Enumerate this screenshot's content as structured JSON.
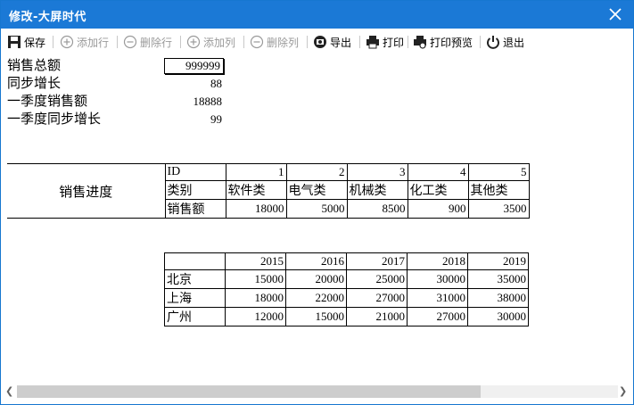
{
  "window": {
    "title": "修改-大屏时代",
    "close_label": "×"
  },
  "toolbar": {
    "save": "保存",
    "add_row": "添加行",
    "delete_row": "删除行",
    "add_col": "添加列",
    "delete_col": "删除列",
    "export": "导出",
    "print": "打印",
    "print_preview": "打印预览",
    "exit": "退出"
  },
  "summary": {
    "labels": [
      "销售总额",
      "同步增长",
      "一季度销售额",
      "一季度同步增长"
    ],
    "values": [
      "999999",
      "88",
      "18888",
      "99"
    ]
  },
  "progress": {
    "title": "销售进度",
    "header": [
      "ID",
      "1",
      "2",
      "3",
      "4",
      "5"
    ],
    "category_row": [
      "类别",
      "软件类",
      "电气类",
      "机械类",
      "化工类",
      "其他类"
    ],
    "sales_row": [
      "销售额",
      "18000",
      "5000",
      "8500",
      "900",
      "3500"
    ]
  },
  "yearly": {
    "years": [
      "2015",
      "2016",
      "2017",
      "2018",
      "2019"
    ],
    "rows": [
      {
        "city": "北京",
        "values": [
          "15000",
          "20000",
          "25000",
          "30000",
          "35000"
        ]
      },
      {
        "city": "上海",
        "values": [
          "18000",
          "22000",
          "27000",
          "31000",
          "38000"
        ]
      },
      {
        "city": "广州",
        "values": [
          "12000",
          "15000",
          "21000",
          "27000",
          "30000"
        ]
      }
    ]
  }
}
